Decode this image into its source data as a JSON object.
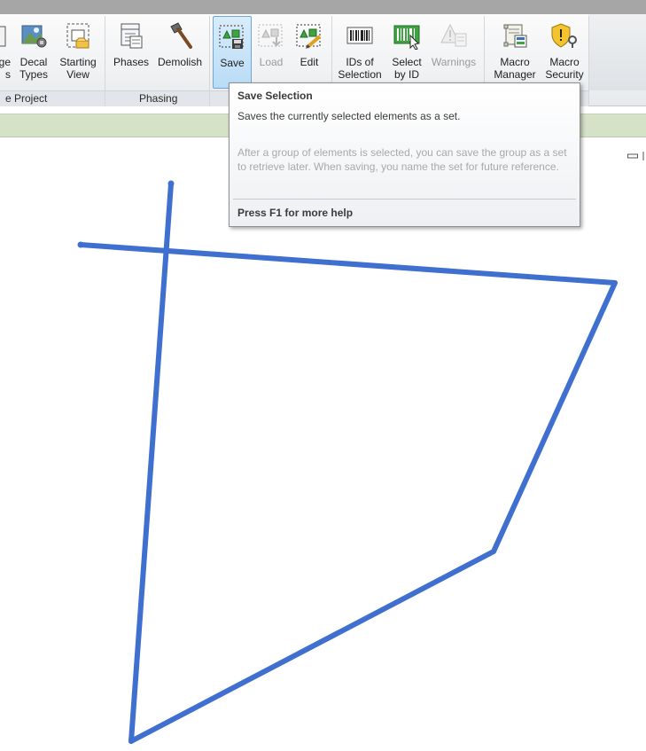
{
  "ribbon": {
    "buttons": [
      {
        "key": "cut-left",
        "label1": "ge",
        "label2": "s"
      },
      {
        "key": "decal-types",
        "label1": "Decal",
        "label2": "Types"
      },
      {
        "key": "starting-view",
        "label1": "Starting",
        "label2": "View"
      },
      {
        "key": "phases",
        "label1": "Phases",
        "label2": ""
      },
      {
        "key": "demolish",
        "label1": "Demolish",
        "label2": ""
      },
      {
        "key": "save",
        "label1": "Save",
        "label2": ""
      },
      {
        "key": "load",
        "label1": "Load",
        "label2": ""
      },
      {
        "key": "edit",
        "label1": "Edit",
        "label2": ""
      },
      {
        "key": "ids-of-selection",
        "label1": "IDs of",
        "label2": "Selection"
      },
      {
        "key": "select-by-id",
        "label1": "Select",
        "label2": "by ID"
      },
      {
        "key": "warnings",
        "label1": "Warnings",
        "label2": ""
      },
      {
        "key": "macro-manager",
        "label1": "Macro",
        "label2": "Manager"
      },
      {
        "key": "macro-security",
        "label1": "Macro",
        "label2": "Security"
      }
    ],
    "panels": {
      "manage_project": "e Project",
      "phasing": "Phasing"
    }
  },
  "tooltip": {
    "title": "Save Selection",
    "description": "Saves the currently selected elements as a set.",
    "detail": "After a group of elements is selected, you can save the group as a set to retrieve later. When saving, you name the set for future reference.",
    "help": "Press F1 for more help"
  },
  "colors": {
    "line": "#3f6fcf",
    "options_bar": "#d6e2c8",
    "active_button": "#b9dcf6"
  }
}
